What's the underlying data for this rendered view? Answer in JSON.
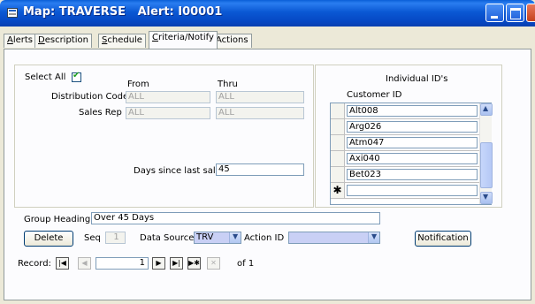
{
  "window": {
    "title": "Map: TRAVERSE   Alert: I00001"
  },
  "tabs": [
    {
      "label": "Alerts",
      "underline": "A",
      "rest": "lerts"
    },
    {
      "label": "Description",
      "underline": "D",
      "rest": "escription"
    },
    {
      "label": "Schedule",
      "underline": "S",
      "rest": "chedule"
    },
    {
      "label": "Criteria/Notify",
      "underline": "C",
      "rest": "riteria/Notify"
    },
    {
      "label": "Actions",
      "underline": "A",
      "pre": "Ac",
      "post": "tions"
    }
  ],
  "criteria": {
    "select_all_label": "Select All",
    "select_all_checked": "✔",
    "from_label": "From",
    "thru_label": "Thru",
    "distribution_code_label": "Distribution Code",
    "distribution_code_from": "ALL",
    "distribution_code_thru": "ALL",
    "sales_rep_label": "Sales Rep",
    "sales_rep_from": "ALL",
    "sales_rep_thru": "ALL",
    "days_since_label": "Days since last sale",
    "days_since_value": "45"
  },
  "ids": {
    "title": "Individual ID's",
    "column": "Customer ID",
    "rows": [
      "Alt008",
      "Arg026",
      "Atm047",
      "Axi040",
      "Bet023"
    ],
    "new_row_marker": "✱"
  },
  "bottom": {
    "group_heading_label": "Group Heading",
    "group_heading_value": "Over 45 Days",
    "delete_label": "Delete",
    "seq_label": "Seq",
    "seq_value": "1",
    "data_source_label": "Data Source",
    "data_source_value": "TRV",
    "action_id_label": "Action ID",
    "action_id_value": "",
    "notification_label": "Notification"
  },
  "record_nav": {
    "label": "Record:",
    "current": "1",
    "of_label": "of 1"
  }
}
